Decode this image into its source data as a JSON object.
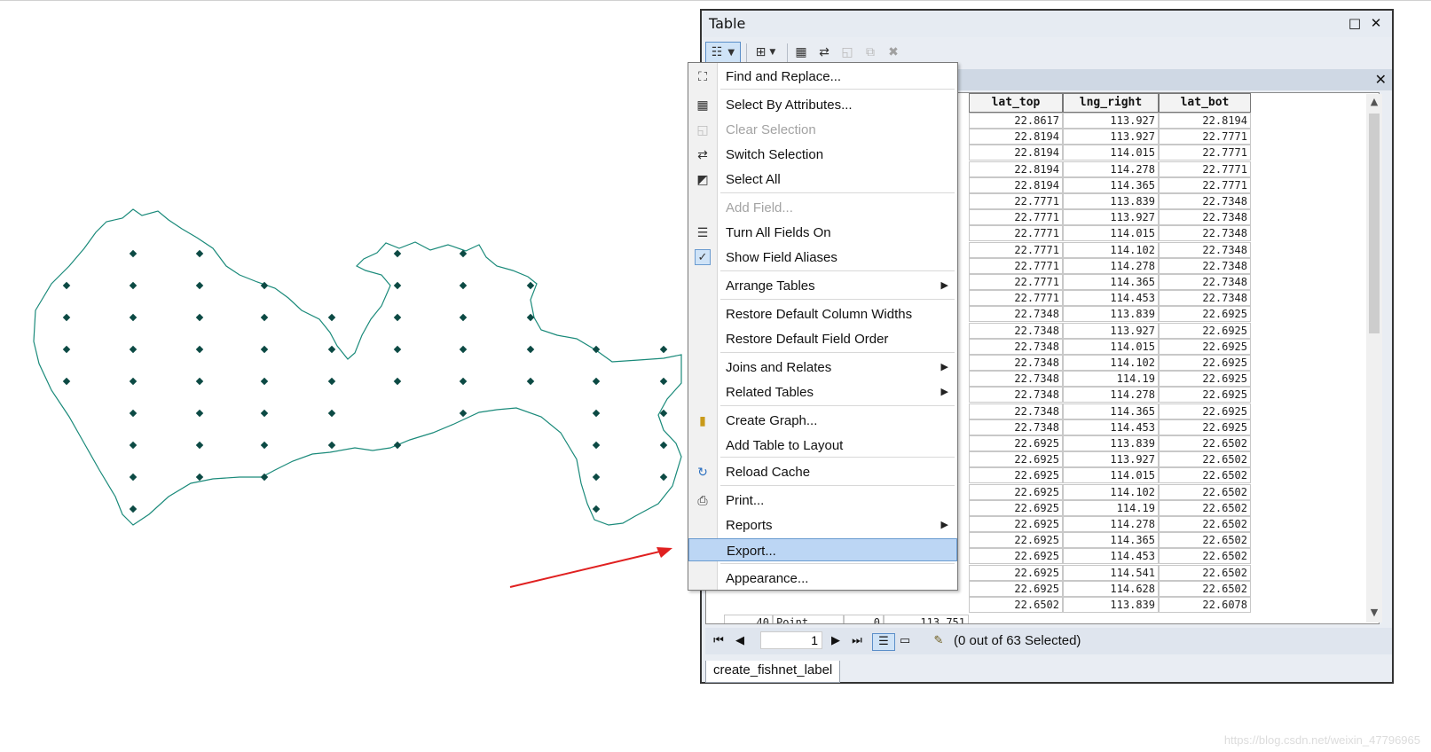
{
  "window": {
    "title": "Table",
    "maximize_icon": "maximize-icon",
    "close_icon": "close-icon",
    "tab_close_icon": "close-icon"
  },
  "toolbar": {
    "table_options_icon": "table-options-icon",
    "dropdown_icon": "chevron-down-icon",
    "related_tables_icon": "related-tables-icon",
    "select_by_attributes_icon": "select-by-attributes-icon",
    "switch_selection_icon": "switch-selection-icon",
    "clear_selection_icon": "clear-selection-icon",
    "zoom_selected_icon": "zoom-selected-icon",
    "delete_icon": "delete-icon"
  },
  "columns": [
    "lat_top",
    "lng_right",
    "lat_bot"
  ],
  "rows": [
    [
      "22.8617",
      "113.927",
      "22.8194"
    ],
    [
      "22.8194",
      "113.927",
      "22.7771"
    ],
    [
      "22.8194",
      "114.015",
      "22.7771"
    ],
    [
      "22.8194",
      "114.278",
      "22.7771"
    ],
    [
      "22.8194",
      "114.365",
      "22.7771"
    ],
    [
      "22.7771",
      "113.839",
      "22.7348"
    ],
    [
      "22.7771",
      "113.927",
      "22.7348"
    ],
    [
      "22.7771",
      "114.015",
      "22.7348"
    ],
    [
      "22.7771",
      "114.102",
      "22.7348"
    ],
    [
      "22.7771",
      "114.278",
      "22.7348"
    ],
    [
      "22.7771",
      "114.365",
      "22.7348"
    ],
    [
      "22.7771",
      "114.453",
      "22.7348"
    ],
    [
      "22.7348",
      "113.839",
      "22.6925"
    ],
    [
      "22.7348",
      "113.927",
      "22.6925"
    ],
    [
      "22.7348",
      "114.015",
      "22.6925"
    ],
    [
      "22.7348",
      "114.102",
      "22.6925"
    ],
    [
      "22.7348",
      "114.19",
      "22.6925"
    ],
    [
      "22.7348",
      "114.278",
      "22.6925"
    ],
    [
      "22.7348",
      "114.365",
      "22.6925"
    ],
    [
      "22.7348",
      "114.453",
      "22.6925"
    ],
    [
      "22.6925",
      "113.839",
      "22.6502"
    ],
    [
      "22.6925",
      "113.927",
      "22.6502"
    ],
    [
      "22.6925",
      "114.015",
      "22.6502"
    ],
    [
      "22.6925",
      "114.102",
      "22.6502"
    ],
    [
      "22.6925",
      "114.19",
      "22.6502"
    ],
    [
      "22.6925",
      "114.278",
      "22.6502"
    ],
    [
      "22.6925",
      "114.365",
      "22.6502"
    ],
    [
      "22.6925",
      "114.453",
      "22.6502"
    ],
    [
      "22.6925",
      "114.541",
      "22.6502"
    ],
    [
      "22.6925",
      "114.628",
      "22.6502"
    ],
    [
      "22.6502",
      "113.839",
      "22.6078"
    ]
  ],
  "partial_row": {
    "fid": "40",
    "shape": "Point",
    "id": "0",
    "lng_left": "113.751"
  },
  "menu": {
    "items": [
      {
        "label": "Find and Replace...",
        "icon": "binoculars-icon",
        "disabled": false,
        "submenu": false
      },
      {
        "label": "Select By Attributes...",
        "icon": "select-by-attributes-icon",
        "disabled": false,
        "submenu": false
      },
      {
        "label": "Clear Selection",
        "icon": "clear-selection-icon",
        "disabled": true,
        "submenu": false
      },
      {
        "label": "Switch Selection",
        "icon": "switch-selection-icon",
        "disabled": false,
        "submenu": false
      },
      {
        "label": "Select All",
        "icon": "select-all-icon",
        "disabled": false,
        "submenu": false
      },
      {
        "label": "Add Field...",
        "icon": "",
        "disabled": true,
        "submenu": false
      },
      {
        "label": "Turn All Fields On",
        "icon": "fields-list-icon",
        "disabled": false,
        "submenu": false
      },
      {
        "label": "Show Field Aliases",
        "icon": "check-icon",
        "disabled": false,
        "submenu": false
      },
      {
        "label": "Arrange Tables",
        "icon": "",
        "disabled": false,
        "submenu": true
      },
      {
        "label": "Restore Default Column Widths",
        "icon": "",
        "disabled": false,
        "submenu": false
      },
      {
        "label": "Restore Default Field Order",
        "icon": "",
        "disabled": false,
        "submenu": false
      },
      {
        "label": "Joins and Relates",
        "icon": "",
        "disabled": false,
        "submenu": true
      },
      {
        "label": "Related Tables",
        "icon": "",
        "disabled": false,
        "submenu": true
      },
      {
        "label": "Create Graph...",
        "icon": "bar-chart-icon",
        "disabled": false,
        "submenu": false
      },
      {
        "label": "Add Table to Layout",
        "icon": "",
        "disabled": false,
        "submenu": false
      },
      {
        "label": "Reload Cache",
        "icon": "refresh-icon",
        "disabled": false,
        "submenu": false
      },
      {
        "label": "Print...",
        "icon": "printer-icon",
        "disabled": false,
        "submenu": false
      },
      {
        "label": "Reports",
        "icon": "",
        "disabled": false,
        "submenu": true
      },
      {
        "label": "Export...",
        "icon": "",
        "disabled": false,
        "submenu": false,
        "highlighted": true
      },
      {
        "label": "Appearance...",
        "icon": "",
        "disabled": false,
        "submenu": false
      }
    ]
  },
  "navigation": {
    "first_icon": "first-record-icon",
    "prev_icon": "previous-record-icon",
    "record": "1",
    "next_icon": "next-record-icon",
    "last_icon": "last-record-icon",
    "show_all_icon": "show-all-records-icon",
    "show_selected_icon": "show-selected-records-icon",
    "status": "(0 out of 63 Selected)"
  },
  "sheet_tab": "create_fishnet_label",
  "watermark": "https://blog.csdn.net/weixin_47796965",
  "colors": {
    "outline": "#1a8a7a",
    "points": "#0c4a44",
    "arrow": "#e02020",
    "highlight": "#bcd6f4"
  }
}
